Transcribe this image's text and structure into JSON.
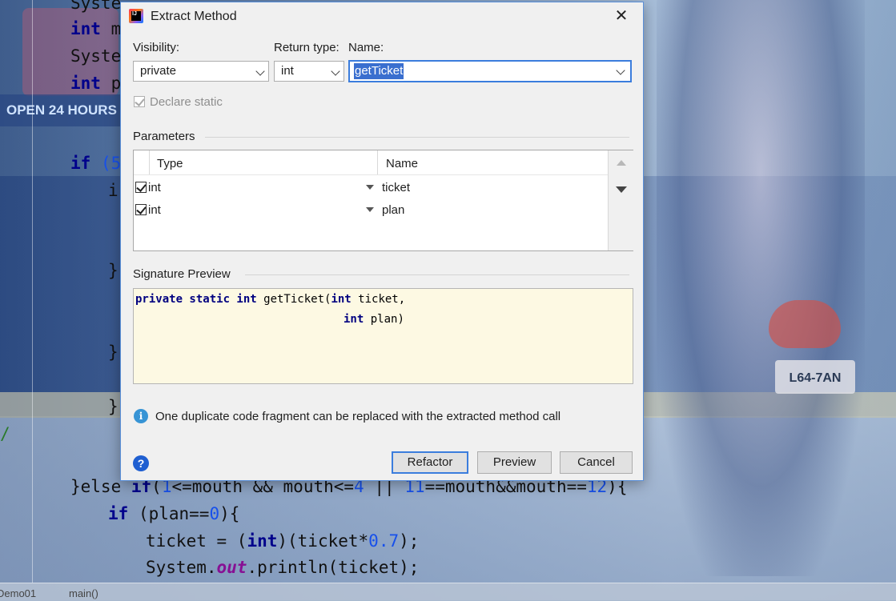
{
  "dialog": {
    "title": "Extract Method",
    "visibility_label": "Visibility:",
    "visibility_value": "private",
    "return_type_label": "Return type:",
    "return_type_value": "int",
    "name_label": "Name:",
    "name_value": "getTicket",
    "declare_static_label": "Declare static",
    "declare_static_checked": true,
    "declare_static_enabled": false,
    "parameters_label": "Parameters",
    "params_columns": [
      "Type",
      "Name"
    ],
    "params_rows": [
      {
        "checked": true,
        "type": "int",
        "name": "ticket"
      },
      {
        "checked": true,
        "type": "int",
        "name": "plan"
      }
    ],
    "signature_label": "Signature Preview",
    "signature_line1_kw": "private static int",
    "signature_line1_rest": " getTicket(",
    "signature_line1_kw2": "int",
    "signature_line1_end": " ticket,",
    "signature_line2_kw": "int",
    "signature_line2_end": " plan)",
    "info_text": "One duplicate code fragment can be replaced with the extracted method call",
    "help_glyph": "?",
    "buttons": {
      "refactor": "Refactor",
      "preview": "Preview",
      "cancel": "Cancel"
    }
  },
  "editor": {
    "lines": [
      {
        "id": "l0",
        "text": "Syste"
      },
      {
        "id": "l1_kw",
        "text": "int"
      },
      {
        "id": "l1_rest",
        "text": " mo"
      },
      {
        "id": "l2",
        "text": "Syste"
      },
      {
        "id": "l3_kw",
        "text": "int"
      },
      {
        "id": "l3_rest",
        "text": " pl"
      },
      {
        "id": "l4_kw",
        "text": "if"
      },
      {
        "id": "l4_rest",
        "text": " (5"
      },
      {
        "id": "l5",
        "text": "i"
      },
      {
        "id": "l6",
        "text": "}"
      },
      {
        "id": "l7",
        "text": "}"
      },
      {
        "id": "l8",
        "text": "}"
      },
      {
        "id": "l9",
        "text": "/"
      }
    ],
    "else_line": {
      "p1": "}else ",
      "kw": "if",
      "p2": "(",
      "n1": "1",
      "p3": "<=mouth && mouth<=",
      "n2": "4",
      "p4": " || ",
      "n3": "11",
      "p5": "==mouth&&mouth==",
      "n4": "12",
      "p6": "){"
    },
    "if_plan_line": {
      "kw": "if",
      "p1": " (plan==",
      "n": "0",
      "p2": "){"
    },
    "ticket_line": {
      "p1": "ticket = (",
      "kw": "int",
      "p2": ")(ticket*",
      "n": "0.7",
      "p3": ");"
    },
    "print_line": {
      "p1": "System.",
      "fld": "out",
      "p2": ".println(ticket);"
    },
    "status": {
      "file": "Demo01",
      "method": "main()"
    }
  },
  "wallpaper": {
    "neon_sign": "OPEN 24 HOURS",
    "plate": "L64-7AN"
  },
  "colors": {
    "accent": "#3b7ddd",
    "preview_bg": "#fdf9e3",
    "keyword": "#000080"
  }
}
